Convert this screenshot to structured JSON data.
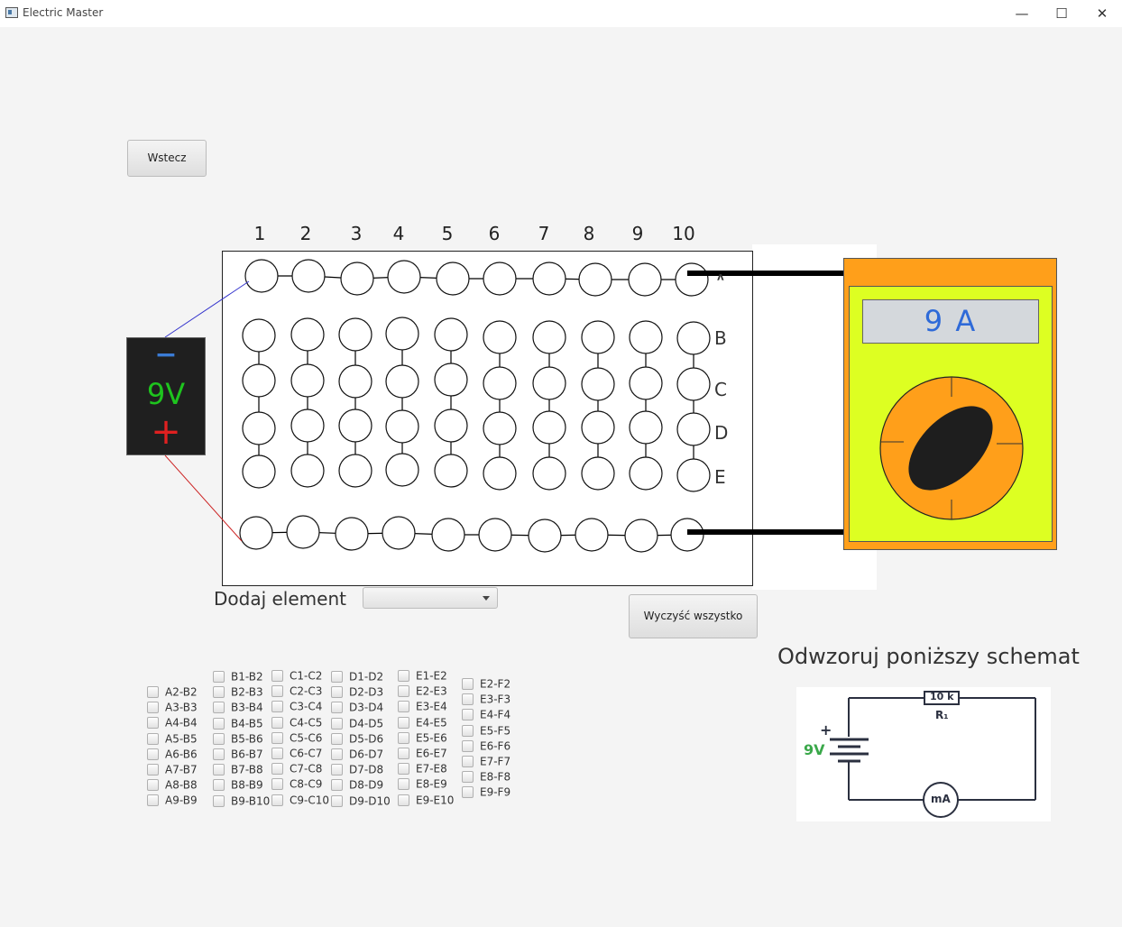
{
  "window": {
    "title": "Electric Master",
    "minimize": "—",
    "maximize": "☐",
    "close": "✕"
  },
  "back_button": "Wstecz",
  "clear_button": "Wyczyść wszystko",
  "add_element_label": "Dodaj element",
  "add_element_select": "",
  "board": {
    "columns": [
      "1",
      "2",
      "3",
      "4",
      "5",
      "6",
      "7",
      "8",
      "9",
      "10"
    ],
    "rows": [
      "A",
      "B",
      "C",
      "D",
      "E"
    ]
  },
  "battery": {
    "minus": "−",
    "voltage": "9V",
    "plus": "+"
  },
  "multimeter": {
    "reading": "9 A"
  },
  "schematic": {
    "title": "Odwzoruj poniższy schemat",
    "resistor_value": "10 k",
    "resistor_label": "R₁",
    "battery_plus": "+",
    "battery_voltage": "9V",
    "meter_label": "mA"
  },
  "colors": {
    "battery_minus": "#3a7bd5",
    "battery_voltage": "#1ec41e",
    "battery_plus": "#e02020",
    "meter_body": "#ff9f1a",
    "meter_face": "#ddff22",
    "meter_reading": "#2e6ad8"
  },
  "checkbox_groups": [
    [
      "A2-B2",
      "A3-B3",
      "A4-B4",
      "A5-B5",
      "A6-B6",
      "A7-B7",
      "A8-B8",
      "A9-B9"
    ],
    [
      "B1-B2",
      "B2-B3",
      "B3-B4",
      "B4-B5",
      "B5-B6",
      "B6-B7",
      "B7-B8",
      "B8-B9",
      "B9-B10"
    ],
    [
      "C1-C2",
      "C2-C3",
      "C3-C4",
      "C4-C5",
      "C5-C6",
      "C6-C7",
      "C7-C8",
      "C8-C9",
      "C9-C10"
    ],
    [
      "D1-D2",
      "D2-D3",
      "D3-D4",
      "D4-D5",
      "D5-D6",
      "D6-D7",
      "D7-D8",
      "D8-D9",
      "D9-D10"
    ],
    [
      "E1-E2",
      "E2-E3",
      "E3-E4",
      "E4-E5",
      "E5-E6",
      "E6-E7",
      "E7-E8",
      "E8-E9",
      "E9-E10"
    ],
    [
      "E2-F2",
      "E3-F3",
      "E4-F4",
      "E5-F5",
      "E6-F6",
      "E7-F7",
      "E8-F8",
      "E9-F9"
    ]
  ]
}
